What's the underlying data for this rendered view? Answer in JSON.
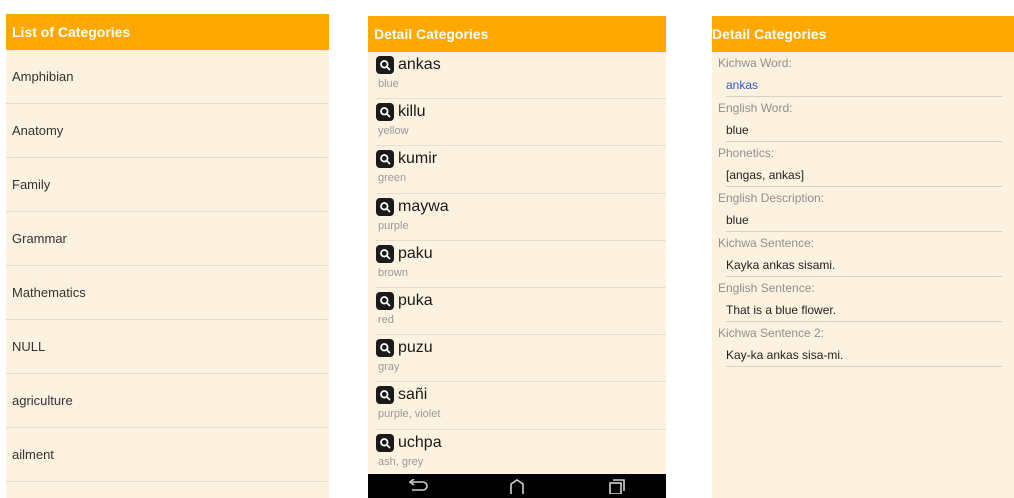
{
  "screen1": {
    "title": "List of Categories",
    "categories": [
      "Amphibian",
      "Anatomy",
      "Family",
      "Grammar",
      "Mathematics",
      "NULL",
      "agriculture",
      "ailment"
    ]
  },
  "screen2": {
    "title": "Detail Categories",
    "words": [
      {
        "word": "ankas",
        "translation": "blue"
      },
      {
        "word": "killu",
        "translation": "yellow"
      },
      {
        "word": "kumir",
        "translation": "green"
      },
      {
        "word": "maywa",
        "translation": "purple"
      },
      {
        "word": "paku",
        "translation": "brown"
      },
      {
        "word": "puka",
        "translation": "red"
      },
      {
        "word": "puzu",
        "translation": "gray"
      },
      {
        "word": "sañi",
        "translation": "purple, violet"
      },
      {
        "word": "uchpa",
        "translation": "ash, grey"
      }
    ],
    "icon": "search-app-icon",
    "nav_icons": [
      "back-icon",
      "home-icon",
      "recent-apps-icon"
    ]
  },
  "screen3": {
    "title": "Detail Categories",
    "fields": [
      {
        "label": "Kichwa Word:",
        "value": "ankas"
      },
      {
        "label": "English Word:",
        "value": "blue"
      },
      {
        "label": "Phonetics:",
        "value": "[angas, ankas]"
      },
      {
        "label": "English Description:",
        "value": "blue"
      },
      {
        "label": "Kichwa Sentence:",
        "value": "Kayka ankas sisami."
      },
      {
        "label": "English Sentence:",
        "value": "That is a blue flower."
      },
      {
        "label": "Kichwa Sentence 2:",
        "value": "Kay-ka ankas sisa-mi."
      }
    ]
  },
  "colors": {
    "appbar": "#ffa800",
    "background": "#fdf2df",
    "link_blue": "#2a5db0"
  }
}
